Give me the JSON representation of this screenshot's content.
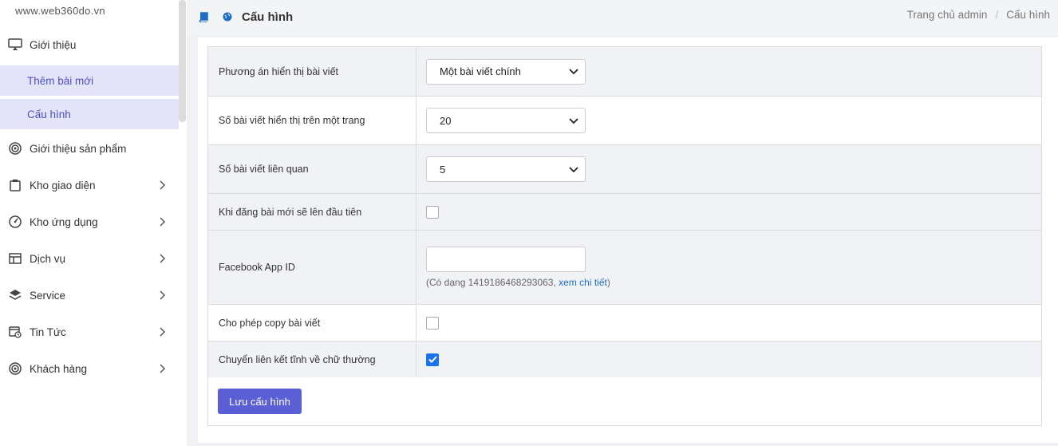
{
  "brand": "www.web360do.vn",
  "sidebar": {
    "items": [
      {
        "label": "Giới thiệu",
        "icon": "monitor-icon"
      },
      {
        "label": "Thêm bài mới"
      },
      {
        "label": "Cấu hình"
      },
      {
        "label": "Giới thiệu sản phẩm",
        "icon": "target-icon"
      },
      {
        "label": "Kho giao diện",
        "icon": "clipboard-icon"
      },
      {
        "label": "Kho ứng dụng",
        "icon": "gauge-icon"
      },
      {
        "label": "Dịch vụ",
        "icon": "table-icon"
      },
      {
        "label": "Service",
        "icon": "layers-icon"
      },
      {
        "label": "Tin Tức",
        "icon": "calendar-clock-icon"
      },
      {
        "label": "Khách hàng",
        "icon": "target-icon"
      }
    ]
  },
  "header": {
    "title": "Cấu hình",
    "breadcrumb": [
      "Trang chủ admin",
      "/",
      "Cấu hình"
    ]
  },
  "form": {
    "rows": [
      {
        "label": "Phương án hiển thị bài viết",
        "value": "Một bài viết chính"
      },
      {
        "label": "Số bài viết hiển thị trên một trang",
        "value": "20"
      },
      {
        "label": "Số bài viết liên quan",
        "value": "5"
      },
      {
        "label": "Khi đăng bài mới sẽ lên đầu tiên",
        "checked": false
      },
      {
        "label": "Facebook App ID",
        "value": "",
        "hint_prefix": "(Có dạng 1419186468293063, ",
        "hint_link": "xem chi tiết",
        "hint_suffix": ")"
      },
      {
        "label": "Cho phép copy bài viết",
        "checked": false
      },
      {
        "label": "Chuyển liên kết tĩnh về chữ thường",
        "checked": true
      }
    ],
    "submit_label": "Lưu cấu hình"
  },
  "colors": {
    "accent": "#5a5fd6",
    "submenu_bg": "#e4e4f8",
    "submenu_text": "#4d4fc4",
    "link": "#1e6ec8"
  }
}
